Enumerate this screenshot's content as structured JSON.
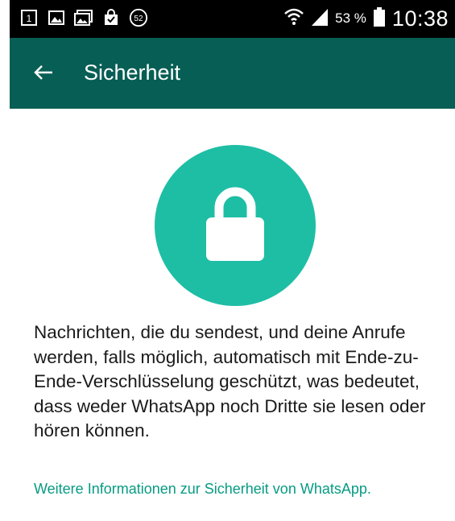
{
  "status_bar": {
    "notification_icons": [
      "sim-card-icon",
      "image-icon",
      "gallery-icon",
      "shopping-bag-icon",
      "badge-icon"
    ],
    "notification_badge_count": "52",
    "battery_percent": "53 %",
    "time": "10:38"
  },
  "toolbar": {
    "title": "Sicherheit",
    "back_icon": "arrow-left-icon"
  },
  "main": {
    "illustration_icon": "lock-icon",
    "description": "Nachrichten, die du sendest, und deine Anrufe werden, falls möglich, automatisch mit Ende-zu-Ende-Verschlüsselung geschützt, was bedeutet, dass weder WhatsApp noch Dritte sie lesen oder hören können.",
    "link_text": "Weitere Informationen zur Sicherheit von WhatsApp."
  },
  "colors": {
    "toolbar_bg": "#075e54",
    "accent_circle": "#1ebea5",
    "link": "#079b83",
    "status_bar_bg": "#000000"
  }
}
